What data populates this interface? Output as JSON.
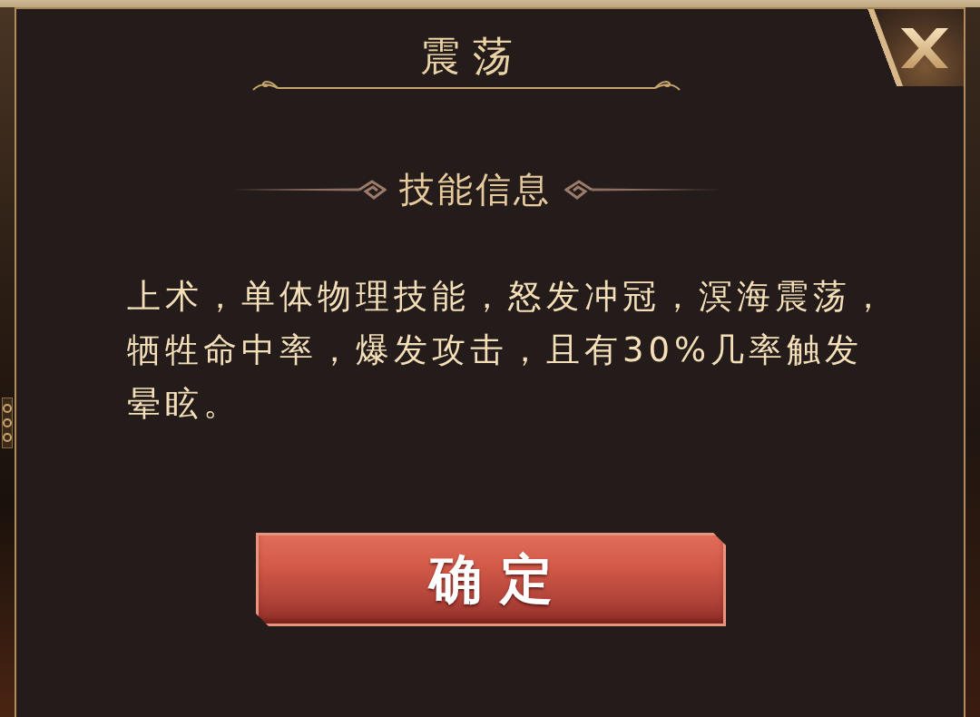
{
  "dialog": {
    "title": "震 荡",
    "section_heading": "技能信息",
    "description": "上术，单体物理技能，怒发冲冠，溟海震荡，牺牲命中率，爆发攻击，且有30%几率触发晕眩。",
    "confirm_button": {
      "label": "确 定"
    }
  }
}
